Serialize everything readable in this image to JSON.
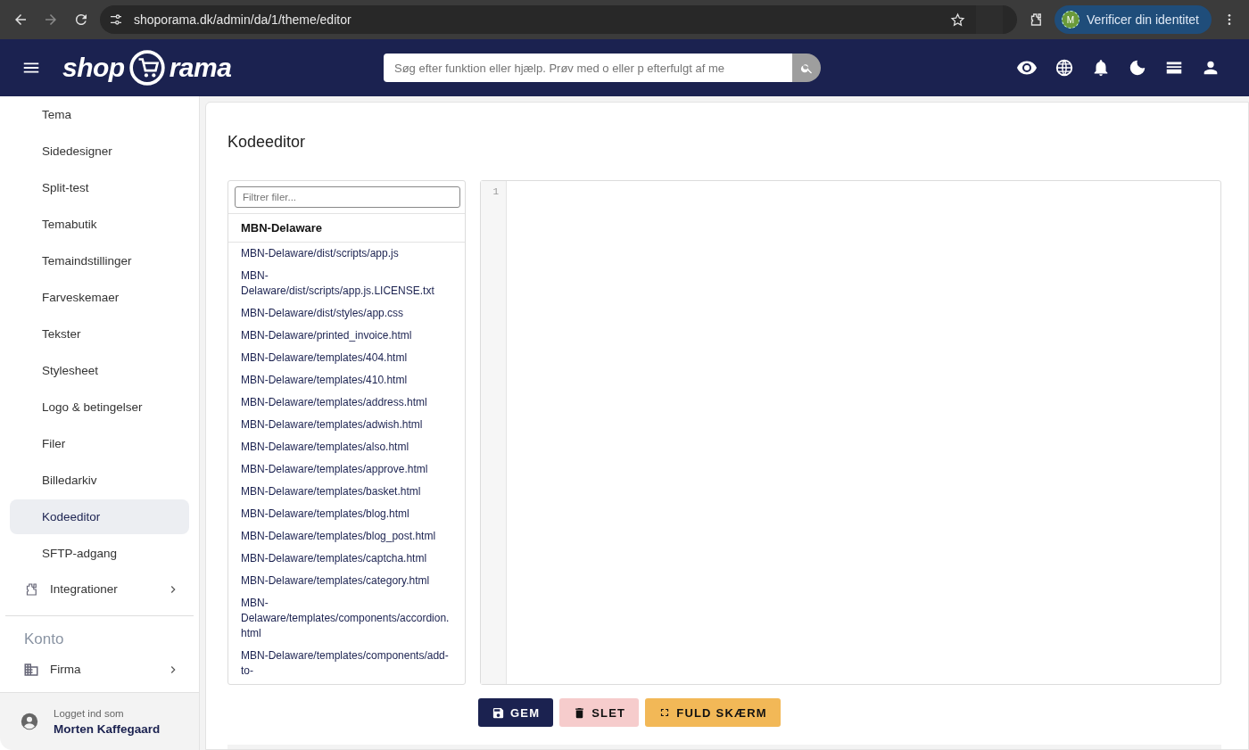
{
  "browser": {
    "url": "shoporama.dk/admin/da/1/theme/editor",
    "profile_initial": "M",
    "profile_label": "Verificer din identitet"
  },
  "header": {
    "logo_left": "shop",
    "logo_right": "rama",
    "search_placeholder": "Søg efter funktion eller hjælp. Prøv med o eller p efterfulgt af me"
  },
  "sidebar": {
    "items": [
      {
        "label": "Tema",
        "selected": false
      },
      {
        "label": "Sidedesigner",
        "selected": false
      },
      {
        "label": "Split-test",
        "selected": false
      },
      {
        "label": "Temabutik",
        "selected": false
      },
      {
        "label": "Temaindstillinger",
        "selected": false
      },
      {
        "label": "Farveskemaer",
        "selected": false
      },
      {
        "label": "Tekster",
        "selected": false
      },
      {
        "label": "Stylesheet",
        "selected": false
      },
      {
        "label": "Logo & betingelser",
        "selected": false
      },
      {
        "label": "Filer",
        "selected": false
      },
      {
        "label": "Billedarkiv",
        "selected": false
      },
      {
        "label": "Kodeeditor",
        "selected": true
      },
      {
        "label": "SFTP-adgang",
        "selected": false
      }
    ],
    "groups": [
      {
        "label": "Integrationer"
      }
    ],
    "section_title": "Konto",
    "account_items": [
      {
        "label": "Firma"
      }
    ],
    "footer": {
      "caption": "Logget ind som",
      "name": "Morten Kaffegaard"
    }
  },
  "main": {
    "title": "Kodeeditor",
    "filter_placeholder": "Filtrer filer...",
    "folder": "MBN-Delaware",
    "files": [
      "MBN-Delaware/dist/scripts/app.js",
      "MBN-Delaware/dist/scripts/app.js.LICENSE.txt",
      "MBN-Delaware/dist/styles/app.css",
      "MBN-Delaware/printed_invoice.html",
      "MBN-Delaware/templates/404.html",
      "MBN-Delaware/templates/410.html",
      "MBN-Delaware/templates/address.html",
      "MBN-Delaware/templates/adwish.html",
      "MBN-Delaware/templates/also.html",
      "MBN-Delaware/templates/approve.html",
      "MBN-Delaware/templates/basket.html",
      "MBN-Delaware/templates/blog.html",
      "MBN-Delaware/templates/blog_post.html",
      "MBN-Delaware/templates/captcha.html",
      "MBN-Delaware/templates/category.html",
      "MBN-Delaware/templates/components/accordion.html",
      "MBN-Delaware/templates/components/add-to-"
    ],
    "line_numbers": [
      "1"
    ],
    "buttons": [
      {
        "label": "GEM",
        "kind": "save"
      },
      {
        "label": "SLET",
        "kind": "delete"
      },
      {
        "label": "FULD SKÆRM",
        "kind": "fullscreen"
      }
    ]
  }
}
